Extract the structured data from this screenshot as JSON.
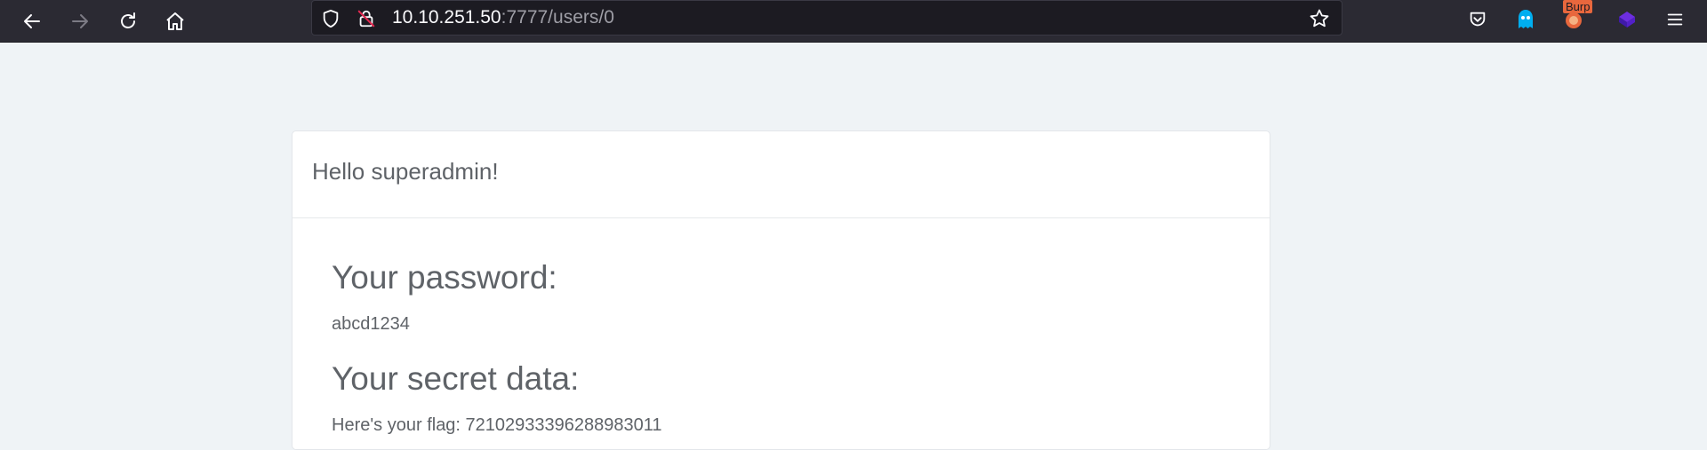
{
  "browser": {
    "url_host": "10.10.251.50",
    "url_rest": ":7777/users/0",
    "nav_icons": [
      "back-icon",
      "forward-icon",
      "reload-icon",
      "home-icon"
    ],
    "url_icons": [
      "shield-icon",
      "insecure-lock-icon",
      "bookmark-star-icon"
    ],
    "extension_icons": [
      "pocket-icon",
      "ghostery-icon",
      "burp-icon",
      "extension-cube-icon",
      "menu-icon"
    ],
    "burp_badge": "Burp"
  },
  "page": {
    "greeting": "Hello superadmin!",
    "password_heading": "Your password:",
    "password_value": "abcd1234",
    "secret_heading": "Your secret data:",
    "secret_value": "Here's your flag: 72102933396288983011"
  },
  "colors": {
    "toolbar_bg": "#2b2a33",
    "urlbar_bg": "#1c1b22",
    "page_bg": "#eff3f6",
    "card_bg": "#ffffff",
    "text": "#5f6368"
  }
}
